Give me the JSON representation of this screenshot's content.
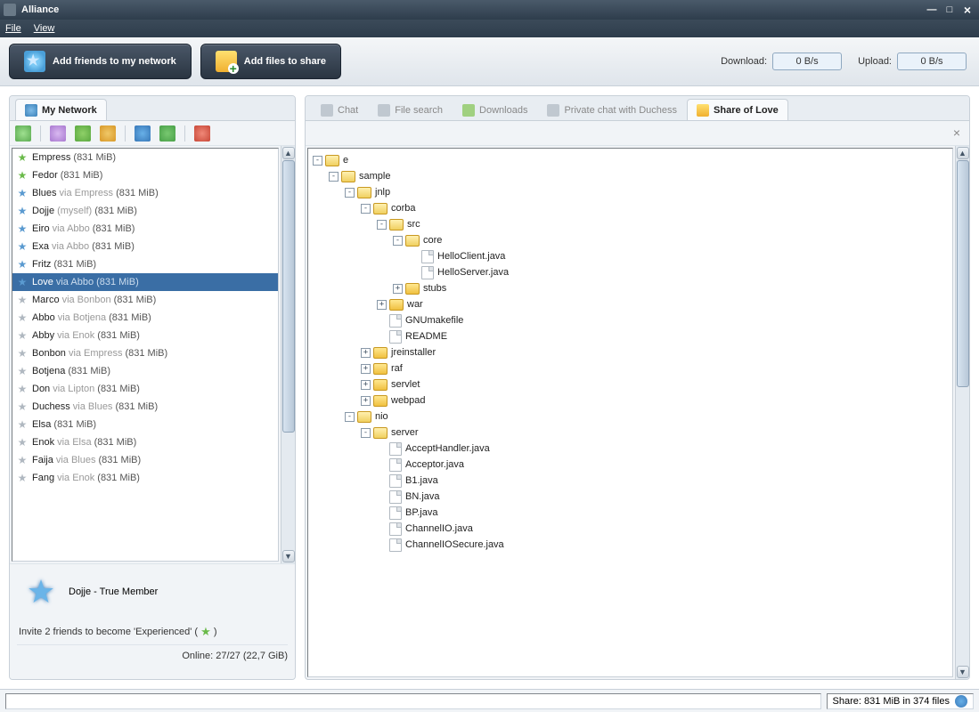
{
  "titlebar": {
    "appname": "Alliance"
  },
  "menubar": {
    "file": "File",
    "view": "View"
  },
  "toolbar": {
    "add_friends": "Add friends to my network",
    "add_files": "Add files to share",
    "download_label": "Download:",
    "download_speed": "0 B/s",
    "upload_label": "Upload:",
    "upload_speed": "0 B/s"
  },
  "left_tab": {
    "label": "My  Network"
  },
  "right_tabs": {
    "chat": "Chat",
    "file_search": "File search",
    "downloads": "Downloads",
    "private_chat": "Private chat with Duchess",
    "share": "Share of Love"
  },
  "friends": [
    {
      "star": "green",
      "name": "Empress",
      "via": "",
      "size": "(831 MiB)"
    },
    {
      "star": "green",
      "name": "Fedor",
      "via": "",
      "size": "(831 MiB)"
    },
    {
      "star": "blue",
      "name": "Blues",
      "via": "via Empress",
      "size": "(831 MiB)"
    },
    {
      "star": "blue",
      "name": "Dojje",
      "via": "(myself)",
      "size": "(831 MiB)"
    },
    {
      "star": "blue",
      "name": "Eiro",
      "via": "via Abbo",
      "size": "(831 MiB)"
    },
    {
      "star": "blue",
      "name": "Exa",
      "via": "via Abbo",
      "size": "(831 MiB)"
    },
    {
      "star": "blue",
      "name": "Fritz",
      "via": "",
      "size": "(831 MiB)"
    },
    {
      "star": "blue",
      "name": "Love",
      "via": "via Abbo",
      "size": "(831 MiB)",
      "selected": true
    },
    {
      "star": "grey",
      "name": "Marco",
      "via": "via Bonbon",
      "size": "(831 MiB)"
    },
    {
      "star": "grey",
      "name": "Abbo",
      "via": "via Botjena",
      "size": "(831 MiB)"
    },
    {
      "star": "grey",
      "name": "Abby",
      "via": "via Enok",
      "size": "(831 MiB)"
    },
    {
      "star": "grey",
      "name": "Bonbon",
      "via": "via Empress",
      "size": "(831 MiB)"
    },
    {
      "star": "grey",
      "name": "Botjena",
      "via": "",
      "size": "(831 MiB)"
    },
    {
      "star": "grey",
      "name": "Don",
      "via": "via Lipton",
      "size": "(831 MiB)"
    },
    {
      "star": "grey",
      "name": "Duchess",
      "via": "via Blues",
      "size": "(831 MiB)"
    },
    {
      "star": "grey",
      "name": "Elsa",
      "via": "",
      "size": "(831 MiB)"
    },
    {
      "star": "grey",
      "name": "Enok",
      "via": "via Elsa",
      "size": "(831 MiB)"
    },
    {
      "star": "grey",
      "name": "Faija",
      "via": "via Blues",
      "size": "(831 MiB)"
    },
    {
      "star": "grey",
      "name": "Fang",
      "via": "via Enok",
      "size": "(831 MiB)"
    }
  ],
  "member": {
    "name": "Dojje",
    "sep": "  -  ",
    "rank": "True Member"
  },
  "invite": {
    "prefix": "Invite 2 friends to become 'Experienced' ( ",
    "suffix": " )"
  },
  "online_status": "Online: 27/27 (22,7 GiB)",
  "tree": [
    {
      "indent": 0,
      "exp": "-",
      "type": "folder-open",
      "label": "e"
    },
    {
      "indent": 1,
      "exp": "-",
      "type": "folder-open",
      "label": "sample"
    },
    {
      "indent": 2,
      "exp": "-",
      "type": "folder-open",
      "label": "jnlp"
    },
    {
      "indent": 3,
      "exp": "-",
      "type": "folder-open",
      "label": "corba"
    },
    {
      "indent": 4,
      "exp": "-",
      "type": "folder-open",
      "label": "src"
    },
    {
      "indent": 5,
      "exp": "-",
      "type": "folder-open",
      "label": "core"
    },
    {
      "indent": 6,
      "exp": "",
      "type": "file",
      "label": "HelloClient.java"
    },
    {
      "indent": 6,
      "exp": "",
      "type": "file",
      "label": "HelloServer.java"
    },
    {
      "indent": 5,
      "exp": "+",
      "type": "folder",
      "label": "stubs"
    },
    {
      "indent": 4,
      "exp": "+",
      "type": "folder",
      "label": "war"
    },
    {
      "indent": 4,
      "exp": "",
      "type": "file",
      "label": "GNUmakefile"
    },
    {
      "indent": 4,
      "exp": "",
      "type": "file",
      "label": "README"
    },
    {
      "indent": 3,
      "exp": "+",
      "type": "folder",
      "label": "jreinstaller"
    },
    {
      "indent": 3,
      "exp": "+",
      "type": "folder",
      "label": "raf"
    },
    {
      "indent": 3,
      "exp": "+",
      "type": "folder",
      "label": "servlet"
    },
    {
      "indent": 3,
      "exp": "+",
      "type": "folder",
      "label": "webpad"
    },
    {
      "indent": 2,
      "exp": "-",
      "type": "folder-open",
      "label": "nio"
    },
    {
      "indent": 3,
      "exp": "-",
      "type": "folder-open",
      "label": "server"
    },
    {
      "indent": 4,
      "exp": "",
      "type": "file",
      "label": "AcceptHandler.java"
    },
    {
      "indent": 4,
      "exp": "",
      "type": "file",
      "label": "Acceptor.java"
    },
    {
      "indent": 4,
      "exp": "",
      "type": "file",
      "label": "B1.java"
    },
    {
      "indent": 4,
      "exp": "",
      "type": "file",
      "label": "BN.java"
    },
    {
      "indent": 4,
      "exp": "",
      "type": "file",
      "label": "BP.java"
    },
    {
      "indent": 4,
      "exp": "",
      "type": "file",
      "label": "ChannelIO.java"
    },
    {
      "indent": 4,
      "exp": "",
      "type": "file",
      "label": "ChannelIOSecure.java"
    }
  ],
  "statusbar": {
    "share": "Share: 831 MiB in 374 files"
  }
}
